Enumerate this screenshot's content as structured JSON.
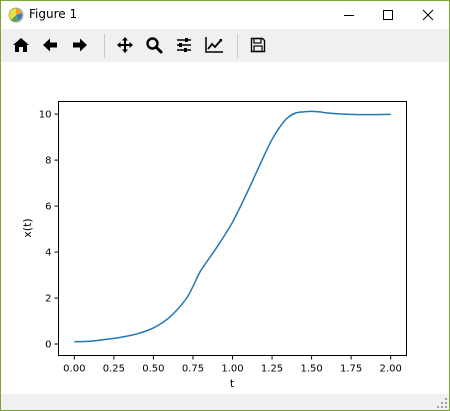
{
  "window": {
    "title": "Figure 1"
  },
  "toolbar": {
    "buttons": [
      {
        "icon": "home-icon"
      },
      {
        "icon": "back-arrow-icon"
      },
      {
        "icon": "forward-arrow-icon"
      },
      {
        "icon": "pan-icon"
      },
      {
        "icon": "zoom-icon"
      },
      {
        "icon": "configure-subplots-icon"
      },
      {
        "icon": "edit-axis-icon"
      },
      {
        "icon": "save-icon"
      }
    ]
  },
  "chart_data": {
    "type": "line",
    "title": "",
    "xlabel": "t",
    "ylabel": "x(t)",
    "xlim": [
      -0.1,
      2.1
    ],
    "ylim": [
      -0.5,
      10.55
    ],
    "x_ticks": [
      "0.00",
      "0.25",
      "0.50",
      "0.75",
      "1.00",
      "1.25",
      "1.50",
      "1.75",
      "2.00"
    ],
    "y_ticks": [
      "0",
      "2",
      "4",
      "6",
      "8",
      "10"
    ],
    "grid": false,
    "series": [
      {
        "color": "#1f77b4",
        "x": [
          0.0,
          0.1,
          0.2,
          0.3,
          0.4,
          0.5,
          0.6,
          0.7,
          0.75,
          0.8,
          0.9,
          1.0,
          1.1,
          1.2,
          1.25,
          1.3,
          1.35,
          1.4,
          1.45,
          1.5,
          1.55,
          1.6,
          1.7,
          1.8,
          1.9,
          2.0
        ],
        "y": [
          0.1,
          0.12,
          0.2,
          0.3,
          0.45,
          0.7,
          1.15,
          1.9,
          2.5,
          3.2,
          4.2,
          5.3,
          6.7,
          8.2,
          8.9,
          9.45,
          9.85,
          10.05,
          10.1,
          10.12,
          10.1,
          10.05,
          10.0,
          9.98,
          9.98,
          9.99
        ]
      }
    ]
  }
}
